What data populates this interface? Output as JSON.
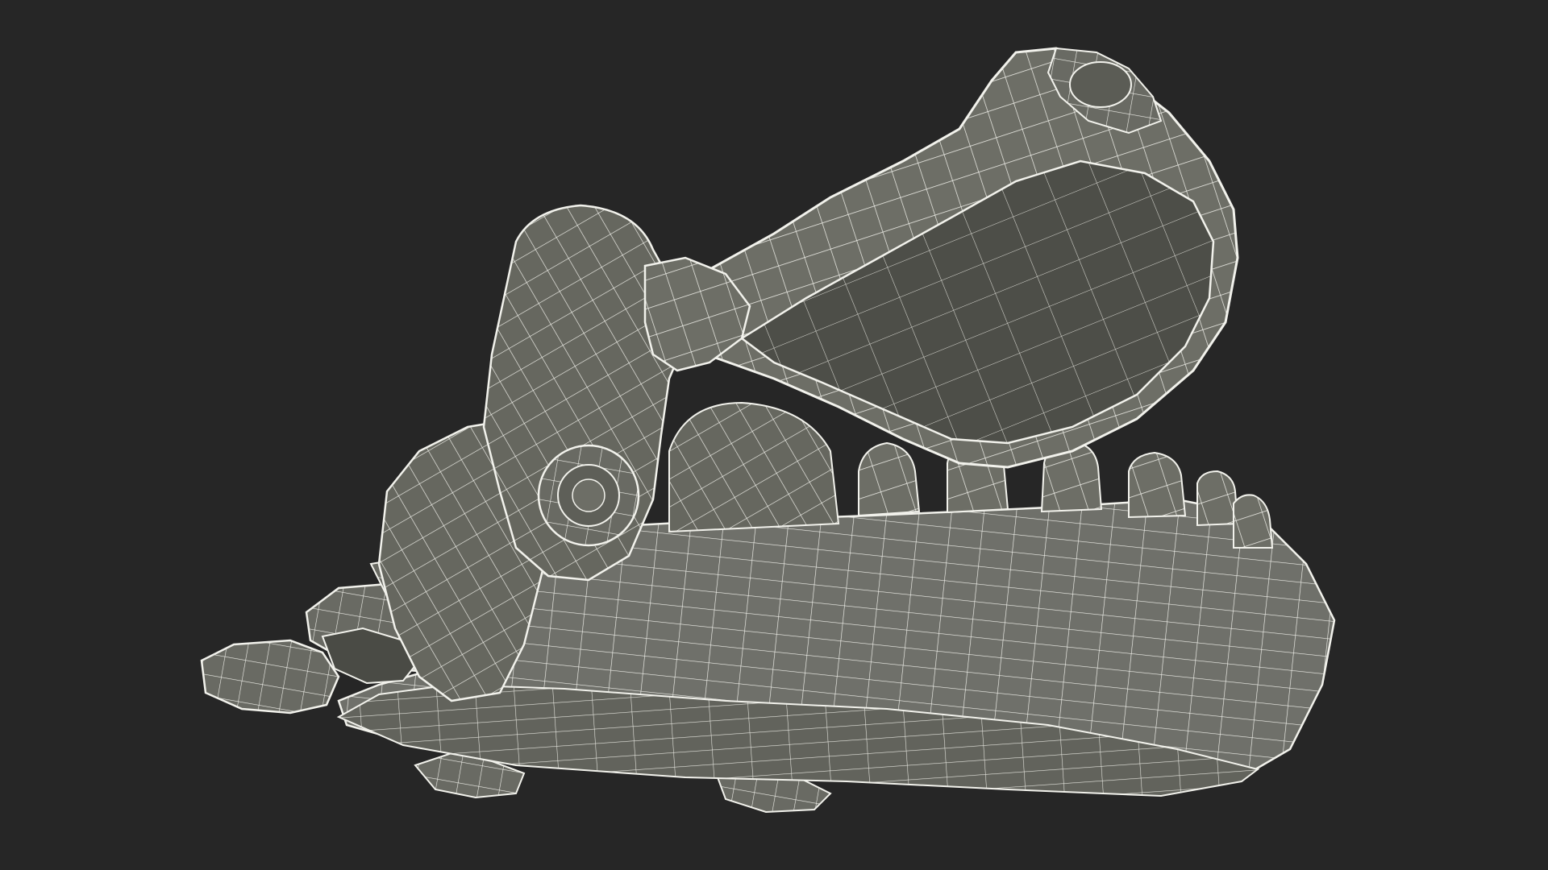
{
  "scene": {
    "subject": "wireframe-3d-model",
    "background_color": "#262626",
    "mesh_fill_color": "#6d6e66",
    "mesh_shade_color": "#4f504a",
    "mesh_dark_color": "#3e3f3a",
    "wire_color": "#f2f2ec"
  }
}
